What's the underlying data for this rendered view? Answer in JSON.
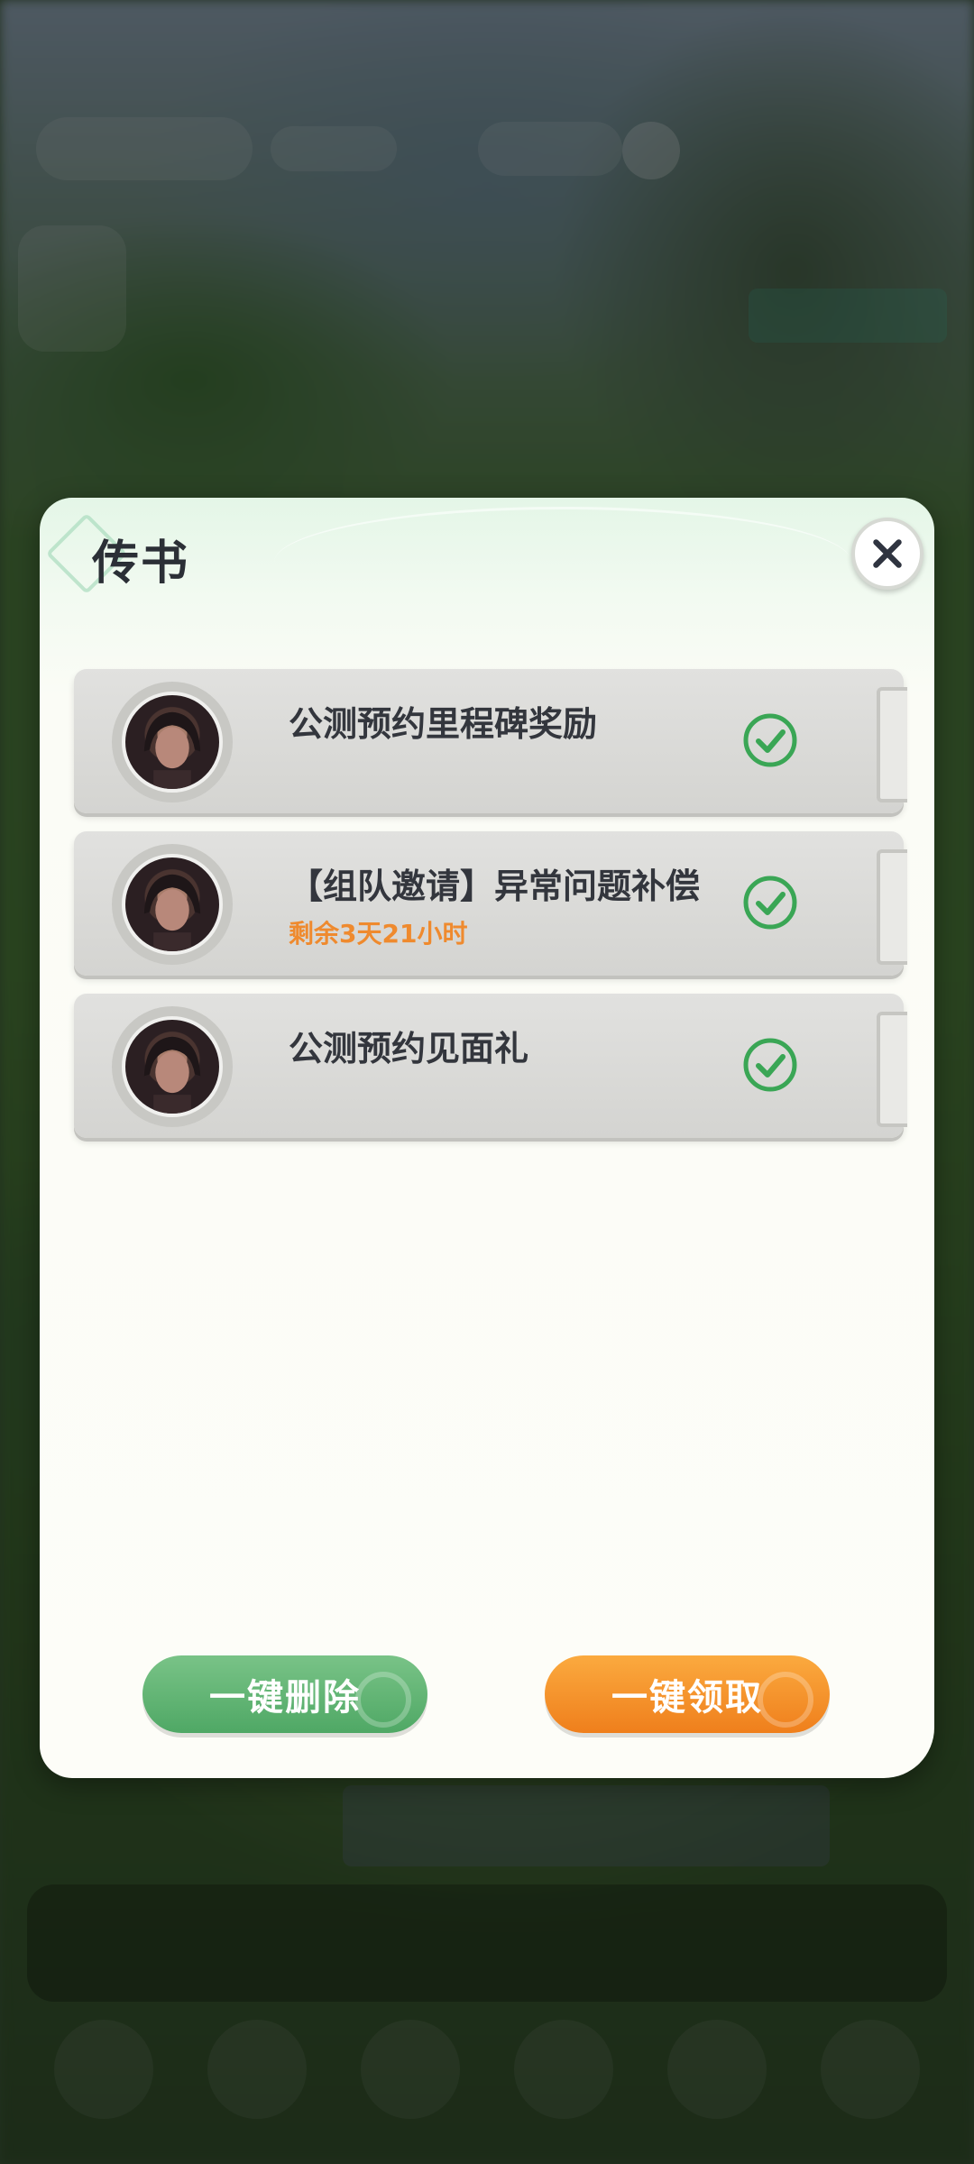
{
  "dialog": {
    "title": "传书",
    "close_icon": "close-icon"
  },
  "mails": [
    {
      "title": "公测预约里程碑奖励",
      "subtitle": "",
      "status_icon": "check-circle-icon",
      "avatar": "npc-avatar"
    },
    {
      "title": "【组队邀请】异常问题补偿",
      "subtitle": "剩余3天21小时",
      "status_icon": "check-circle-icon",
      "avatar": "npc-avatar"
    },
    {
      "title": "公测预约见面礼",
      "subtitle": "",
      "status_icon": "check-circle-icon",
      "avatar": "npc-avatar"
    }
  ],
  "actions": {
    "delete_all_label": "一键删除",
    "claim_all_label": "一键领取"
  },
  "colors": {
    "accent_green": "#4fa865",
    "accent_orange": "#ef7f1c",
    "check_green": "#3aa655",
    "subtitle_orange": "#ef8a2e"
  }
}
